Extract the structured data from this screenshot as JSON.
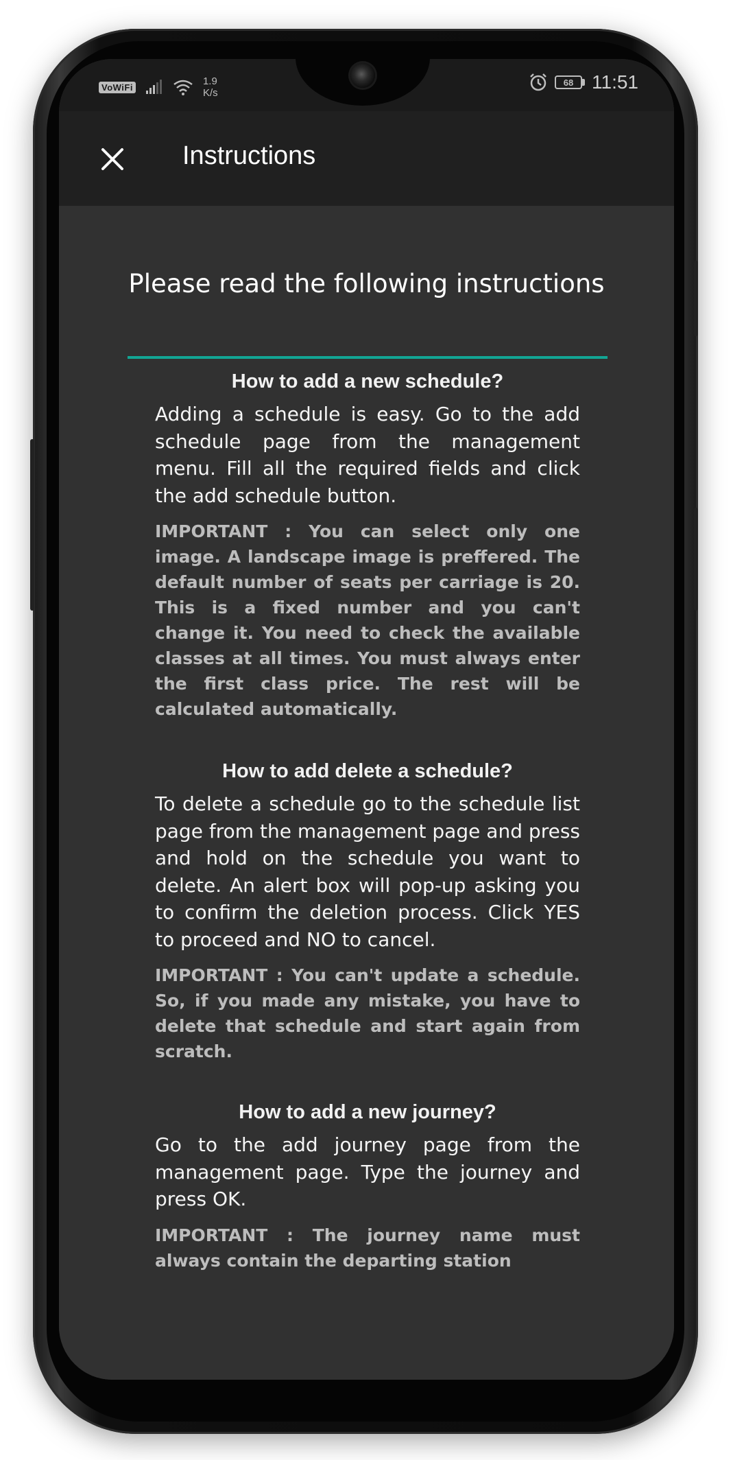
{
  "status_bar": {
    "network_badge": "VoWiFi",
    "speed_value": "1.9",
    "speed_unit": "K/s",
    "battery": "68",
    "time": "11:51"
  },
  "app_bar": {
    "title": "Instructions"
  },
  "content": {
    "heading": "Please read the following instructions",
    "accent_color": "#12a594",
    "sections": [
      {
        "title": "How to add a new schedule?",
        "body": "Adding a schedule is easy. Go to the add schedule page from the management menu. Fill all the required fields and click the add schedule button.",
        "note": "IMPORTANT : You can select only one image. A landscape image is preffered. The default number of seats per carriage is 20. This is a fixed number and you can't change it. You need to check the available classes at all times. You must always enter the first class price. The rest will be calculated automatically."
      },
      {
        "title": "How to add delete a schedule?",
        "body": "To delete a schedule go to the schedule list page from the management page and press and hold on the schedule you want to delete. An alert box will pop-up asking you to confirm the deletion process. Click YES to proceed and NO to cancel.",
        "note": "IMPORTANT : You can't update a schedule. So, if you made any mistake, you have to delete that schedule and start again from scratch."
      },
      {
        "title": "How to add a new journey?",
        "body": "Go to the add journey page from the management page. Type the journey and press OK.",
        "note": "IMPORTANT : The journey name must always contain the departing station"
      }
    ]
  },
  "icons": {
    "close": "close-icon",
    "alarm": "alarm-icon",
    "wifi": "wifi-icon",
    "signal": "signal-icon"
  }
}
